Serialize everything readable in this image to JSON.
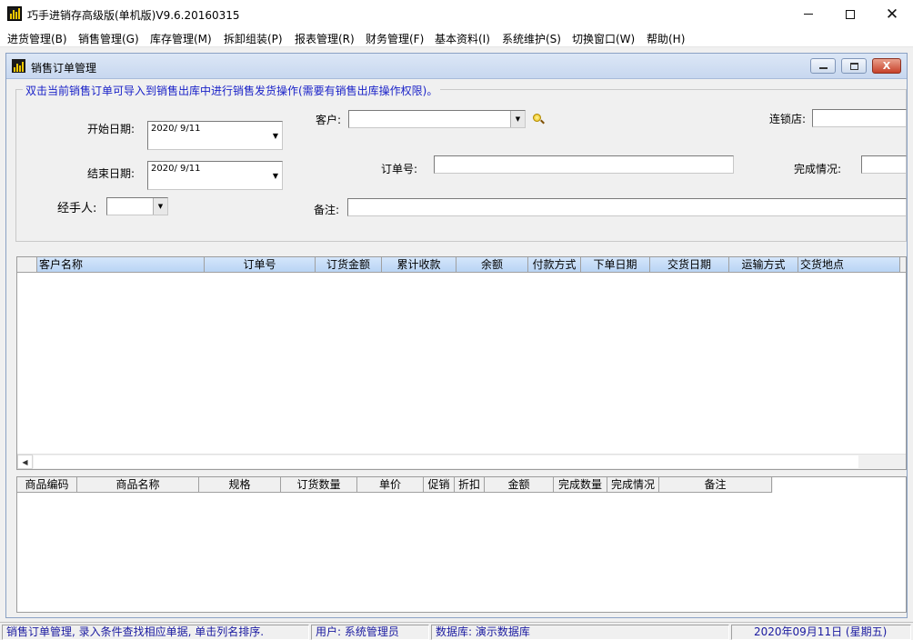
{
  "window": {
    "title": "巧手进销存高级版(单机版)V9.6.20160315",
    "minimize_label": "",
    "close_glyph": "✕"
  },
  "menu": [
    "进货管理(B)",
    "销售管理(G)",
    "库存管理(M)",
    "拆卸组装(P)",
    "报表管理(R)",
    "财务管理(F)",
    "基本资料(I)",
    "系统维护(S)",
    "切换窗口(W)",
    "帮助(H)"
  ],
  "child_window": {
    "title": "销售订单管理",
    "close_glyph": "X"
  },
  "filter": {
    "legend": "双击当前销售订单可导入到销售出库中进行销售发货操作(需要有销售出库操作权限)。",
    "start_date_label": "开始日期:",
    "start_date_value": "2020/ 9/11",
    "end_date_label": "结束日期:",
    "end_date_value": "2020/ 9/11",
    "handler_label": "经手人:",
    "handler_value": "",
    "customer_label": "客户:",
    "customer_value": "",
    "order_no_label": "订单号:",
    "order_no_value": "",
    "remark_label": "备注:",
    "remark_value": "",
    "chain_store_label": "连锁店:",
    "chain_store_value": "",
    "completion_label": "完成情况:",
    "completion_value": ""
  },
  "orders_grid": {
    "columns": [
      "客户名称",
      "订单号",
      "订货金额",
      "累计收款",
      "余额",
      "付款方式",
      "下单日期",
      "交货日期",
      "运输方式",
      "交货地点"
    ],
    "rows": []
  },
  "detail_grid": {
    "columns": [
      "商品编码",
      "商品名称",
      "规格",
      "订货数量",
      "单价",
      "促销",
      "折扣",
      "金额",
      "完成数量",
      "完成情况",
      "备注"
    ],
    "rows": []
  },
  "statusbar": {
    "hint": "销售订单管理, 录入条件查找相应单据, 单击列名排序.",
    "user": "用户: 系统管理员",
    "database": "数据库: 演示数据库",
    "date": "2020年09月11日 (星期五)"
  }
}
